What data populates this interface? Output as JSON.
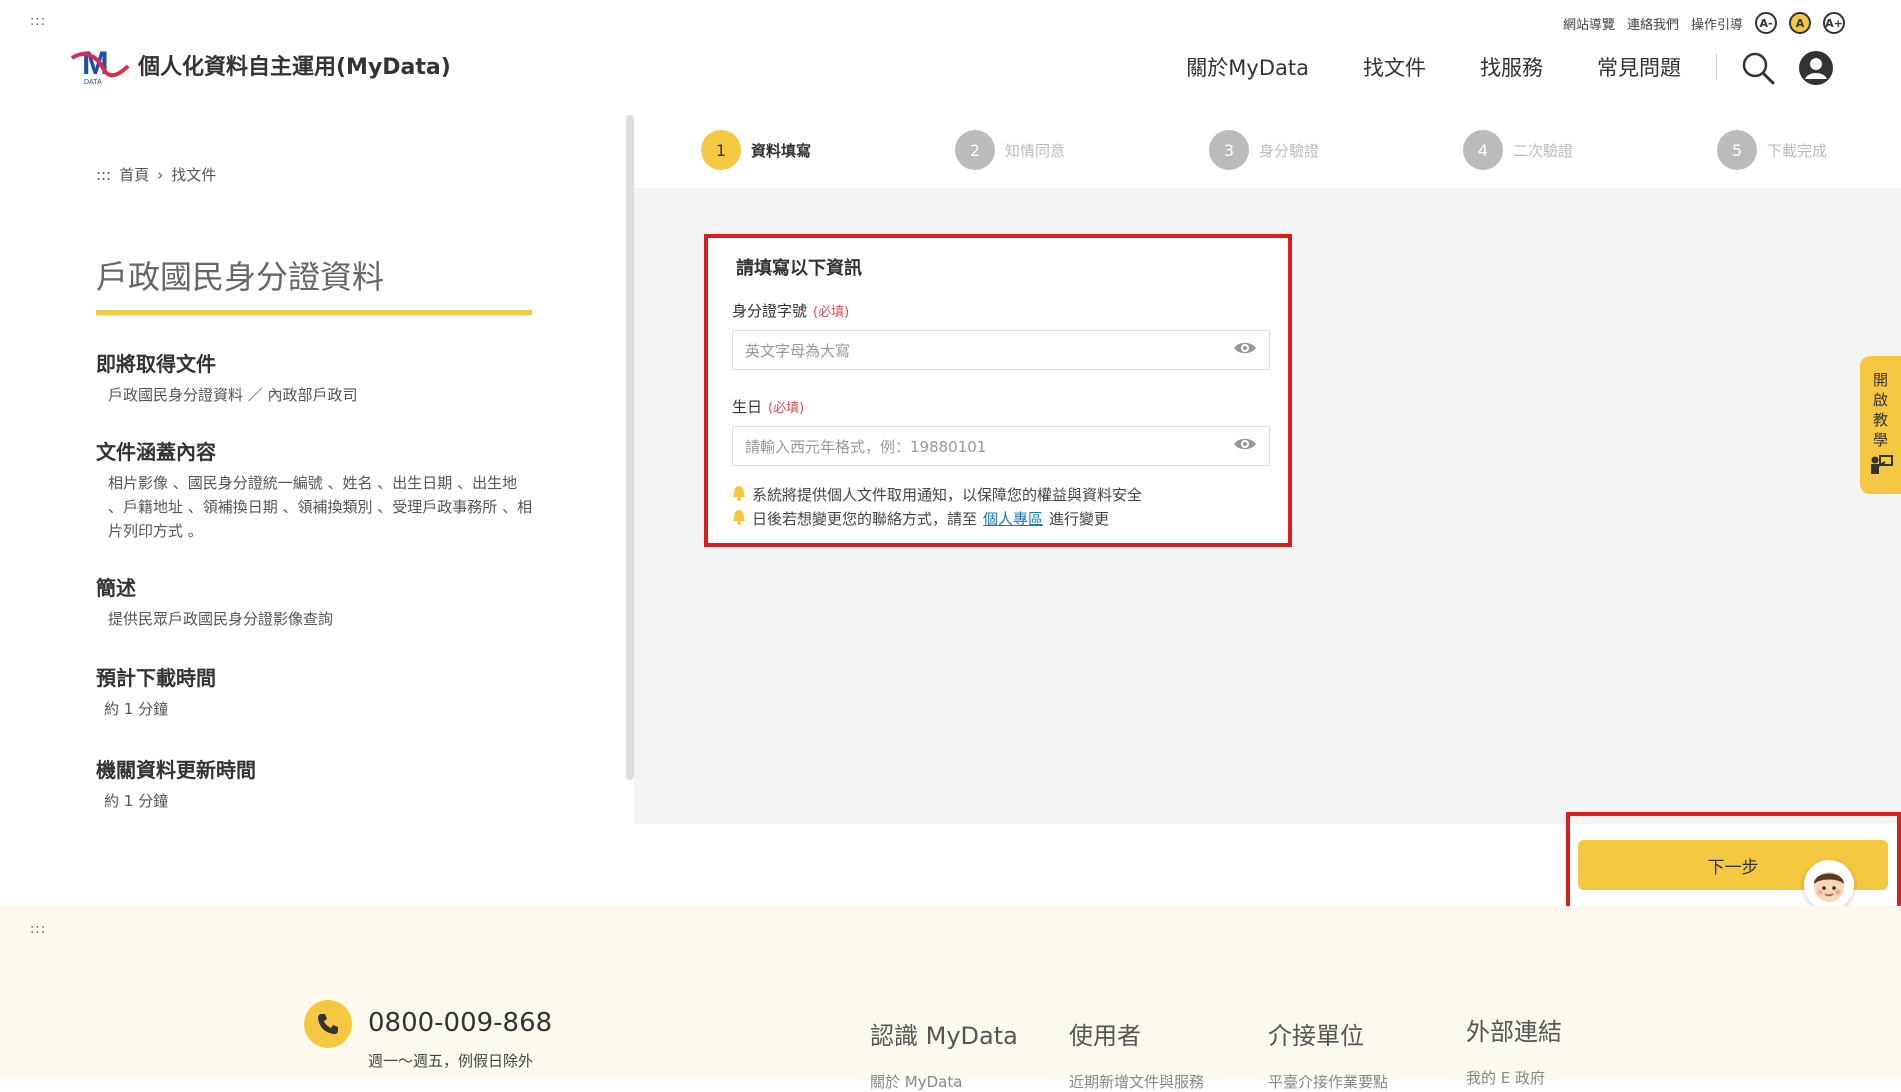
{
  "topbar": {
    "dots": ":::",
    "utility_links": [
      "網站導覽",
      "連絡我們",
      "操作引導"
    ],
    "font_sizes": [
      "A-",
      "A",
      "A+"
    ]
  },
  "logo": {
    "mark": "M",
    "mark_sub": "DATA",
    "title": "個人化資料自主運用(MyData)"
  },
  "nav": [
    "關於MyData",
    "找文件",
    "找服務",
    "常見問題"
  ],
  "breadcrumb": {
    "dots": ":::",
    "home": "首頁",
    "sep": "›",
    "current": "找文件"
  },
  "left": {
    "title": "戶政國民身分證資料",
    "sections": [
      {
        "heading": "即將取得文件",
        "text": "戶政國民身分證資料 ／ 內政部戶政司"
      },
      {
        "heading": "文件涵蓋內容",
        "text": "相片影像 、國民身分證統一編號 、姓名 、出生日期 、出生地 、戶籍地址 、領補換日期 、領補換類別 、受理戶政事務所 、相片列印方式 。"
      },
      {
        "heading": "簡述",
        "text": "提供民眾戶政國民身分證影像查詢"
      },
      {
        "heading": "預計下載時間",
        "text": "約 1 分鐘"
      },
      {
        "heading": "機關資料更新時間",
        "text": "約 1  分鐘"
      }
    ]
  },
  "steps": [
    {
      "num": "1",
      "label": "資料填寫"
    },
    {
      "num": "2",
      "label": "知情同意"
    },
    {
      "num": "3",
      "label": "身分驗證"
    },
    {
      "num": "4",
      "label": "二次驗證"
    },
    {
      "num": "5",
      "label": "下載完成"
    }
  ],
  "form": {
    "heading": "請填寫以下資訊",
    "id_label": "身分證字號",
    "id_required": "(必填)",
    "id_placeholder": "英文字母為大寫",
    "birth_label": "生日",
    "birth_required": "(必填)",
    "birth_placeholder": "請輸入西元年格式，例：19880101",
    "note1": "系統將提供個人文件取用通知，以保障您的權益與資料安全",
    "note2_pre": "日後若想變更您的聯絡方式，請至",
    "note2_link": "個人專區",
    "note2_post": "進行變更"
  },
  "tutorial": [
    "開",
    "啟",
    "教",
    "學"
  ],
  "next_button": "下一步",
  "footer": {
    "dots": ":::",
    "phone": "0800-009-868",
    "phone_hours": "週一～週五，例假日除外",
    "columns": [
      {
        "heading": "認識 MyData",
        "item": "關於 MyData"
      },
      {
        "heading": "使用者",
        "item": "近期新增文件與服務"
      },
      {
        "heading": "介接單位",
        "item": "平臺介接作業要點"
      },
      {
        "heading": "外部連結",
        "item": "我的 E 政府"
      }
    ]
  },
  "colors": {
    "accent": "#f5c842",
    "highlight": "#d81e1e",
    "link": "#1a7ab3",
    "logo_blue": "#1f4fa8",
    "logo_red": "#d82b4f"
  }
}
